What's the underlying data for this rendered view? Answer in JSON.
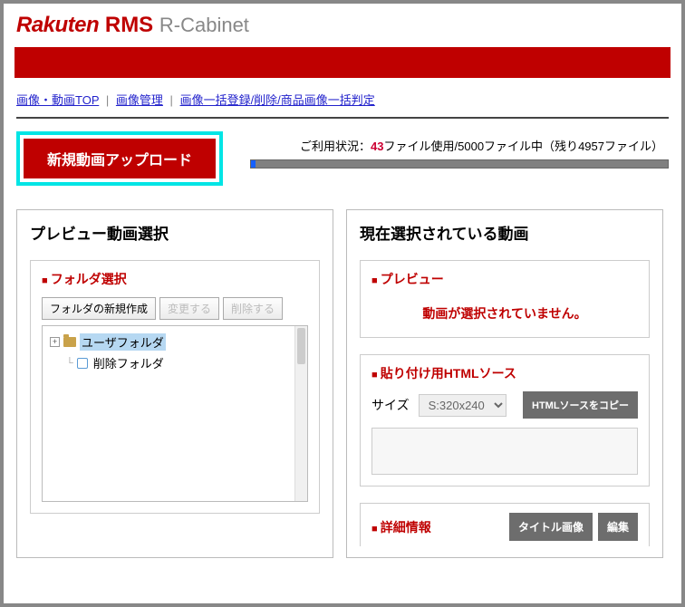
{
  "brand": {
    "rakuten": "Rakuten",
    "rms": "RMS",
    "rcabinet": "R-Cabinet"
  },
  "breadcrumb": {
    "items": [
      "画像・動画TOP",
      "画像管理",
      "画像一括登録/削除/商品画像一括判定"
    ],
    "sep": "|"
  },
  "upload_button": "新規動画アップロード",
  "usage": {
    "prefix": "ご利用状況：",
    "count": "43",
    "mid1": "ファイル使用/",
    "total": "5000",
    "mid2": "ファイル中（残り",
    "remaining": "4957",
    "suffix": "ファイル）"
  },
  "left": {
    "title": "プレビュー動画選択",
    "folder_sel_title": "フォルダ選択",
    "btn_create": "フォルダの新規作成",
    "btn_change": "変更する",
    "btn_delete": "削除する",
    "tree": {
      "user_folder": "ユーザフォルダ",
      "trash_folder": "削除フォルダ"
    }
  },
  "right": {
    "title": "現在選択されている動画",
    "preview_title": "プレビュー",
    "no_selection": "動画が選択されていません。",
    "html_src_title": "貼り付け用HTMLソース",
    "size_label": "サイズ",
    "size_option": "S:320x240",
    "copy_btn": "HTMLソースをコピー",
    "detail_title": "詳細情報",
    "thumb_btn": "タイトル画像",
    "edit_btn": "編集"
  }
}
